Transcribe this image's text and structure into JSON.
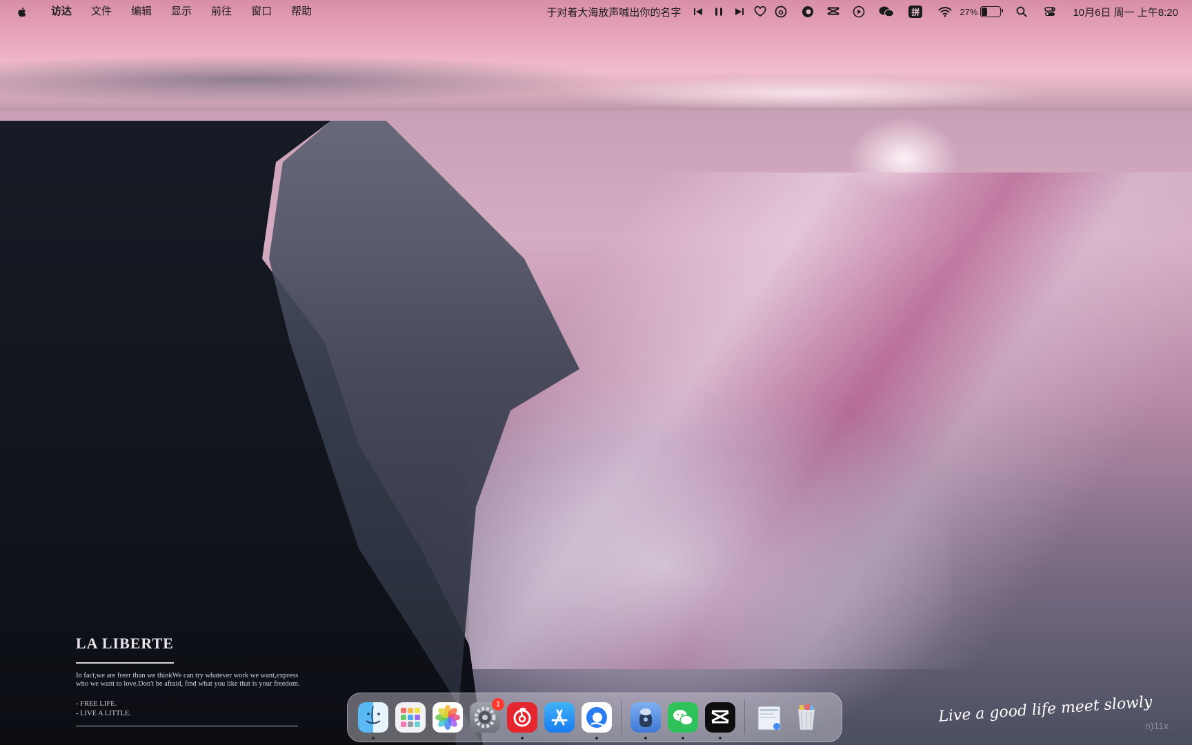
{
  "menubar": {
    "app_name": "访达",
    "menus": [
      "文件",
      "编辑",
      "显示",
      "前往",
      "窗口",
      "帮助"
    ],
    "now_playing": "于对着大海放声喊出你的名字",
    "input_method": "拼",
    "battery_percent": "27%",
    "battery_level": 0.27,
    "clock": "10月6日 周一  上午8:20"
  },
  "desktop": {
    "title": "LA  LIBERTE",
    "body_line1": "In fact,we are freer than we thinkWe can try whatever work we want,express",
    "body_line2": "who we want to love.Don't be afraid, find what you like that is your freedom.",
    "tag1": "- FREE  LIFE.",
    "tag2": "- LIVE A LITTLE.",
    "signature": "Live a good life meet slowly",
    "watermark": "n)11x"
  },
  "dock": {
    "apps": [
      {
        "name": "finder",
        "running": true
      },
      {
        "name": "launchpad",
        "running": false
      },
      {
        "name": "photos",
        "running": false
      },
      {
        "name": "system-settings",
        "running": false,
        "badge": "1"
      },
      {
        "name": "netease-music",
        "running": true
      },
      {
        "name": "app-store",
        "running": false
      },
      {
        "name": "qq-browser",
        "running": true
      },
      {
        "name": "app-cleaner",
        "running": true
      },
      {
        "name": "wechat",
        "running": true
      },
      {
        "name": "capcut",
        "running": true
      },
      {
        "name": "downloads-folder",
        "running": false
      },
      {
        "name": "trash",
        "running": false
      }
    ]
  }
}
